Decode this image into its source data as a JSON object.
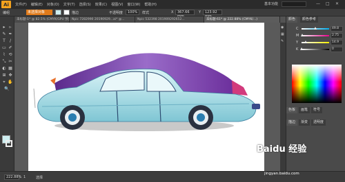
{
  "app": {
    "logo": "Ai",
    "menu": [
      "文件(F)",
      "编辑(E)",
      "对象(O)",
      "文字(T)",
      "选择(S)",
      "效果(C)",
      "视图(V)",
      "窗口(W)",
      "帮助(H)"
    ],
    "workspace": "基本功能",
    "window_controls": [
      "—",
      "□",
      "✕"
    ]
  },
  "control_bar": {
    "selection_label": "编组",
    "mode_value": "未选择对象",
    "stroke_label": "描边",
    "opacity_label": "不透明度",
    "opacity_value": "100%",
    "style_label": "样式",
    "x_label": "X",
    "x_value": "367.66 mm",
    "y_label": "Y",
    "y_value": "123.92 mm"
  },
  "tabs": [
    {
      "label": "未标题-1* @ 82.5% (CMYK/GPU 预览)",
      "active": false
    },
    {
      "label": "Npic 7282990 20190929...ai* @...",
      "active": false
    },
    {
      "label": "Npic 532398 201909292652...",
      "active": false
    },
    {
      "label": "未标题-61* @ 222.88% (CMYK/...)",
      "active": true
    }
  ],
  "tools": [
    "▸",
    "▹",
    "✎",
    "✒",
    "T",
    "/",
    "▭",
    "✐",
    "⌇",
    "⟲",
    "⤡",
    "✂",
    "◐",
    "▦",
    "⊞",
    "✥",
    "⌖",
    "✋",
    "🔍"
  ],
  "swatches": {
    "fill": "#cdeef0",
    "stroke": "#ffffff"
  },
  "colors": {
    "accent": "#e07a1a",
    "car_body": "#a8dde6",
    "car_roof": "#7a3ea8",
    "tire": "#2a3140",
    "rim": "#2a7db0"
  },
  "right_panel": {
    "tabs": [
      "颜色",
      "颜色参考"
    ],
    "sliders": [
      {
        "label": "C",
        "value": "49.8",
        "track": "linear-gradient(to right,#fff,#00aeef)",
        "thumb": 0.5
      },
      {
        "label": "M",
        "value": "2.75",
        "track": "linear-gradient(to right,#fff,#ec008c)",
        "thumb": 0.03
      },
      {
        "label": "Y",
        "value": "14.9",
        "track": "linear-gradient(to right,#fff,#fff200)",
        "thumb": 0.15
      },
      {
        "label": "K",
        "value": "0",
        "track": "linear-gradient(to right,#fff,#000)",
        "thumb": 0.0
      }
    ],
    "lower_tabs": [
      "色板",
      "画笔",
      "符号"
    ],
    "section2_tabs": [
      "描边",
      "渐变",
      "透明度"
    ]
  },
  "status": {
    "zoom": "222.88%",
    "page": "1",
    "tool_name": "选择"
  },
  "watermark": {
    "brand": "Baidu 经验",
    "url": "jingyan.baidu.com"
  }
}
